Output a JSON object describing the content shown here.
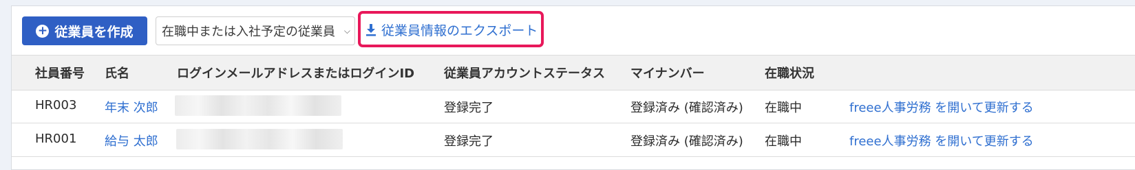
{
  "toolbar": {
    "create_label": "従業員を作成",
    "filter_value": "在職中または入社予定の従業員",
    "export_label": "従業員情報のエクスポート"
  },
  "table": {
    "headers": [
      "社員番号",
      "氏名",
      "ログインメールアドレスまたはログインID",
      "従業員アカウントステータス",
      "マイナンバー",
      "在職状況"
    ],
    "rows": [
      {
        "employee_no": "HR003",
        "name": "年末 次郎",
        "login": "",
        "account_status": "登録完了",
        "my_number": "登録済み (確認済み)",
        "employment": "在職中",
        "action": "freee人事労務 を開いて更新する"
      },
      {
        "employee_no": "HR001",
        "name": "給与 太郎",
        "login": "",
        "account_status": "登録完了",
        "my_number": "登録済み (確認済み)",
        "employment": "在職中",
        "action": "freee人事労務 を開いて更新する"
      }
    ]
  },
  "colors": {
    "primary": "#2f5fc4",
    "link": "#2f6fd0",
    "highlight": "#e8185a"
  }
}
